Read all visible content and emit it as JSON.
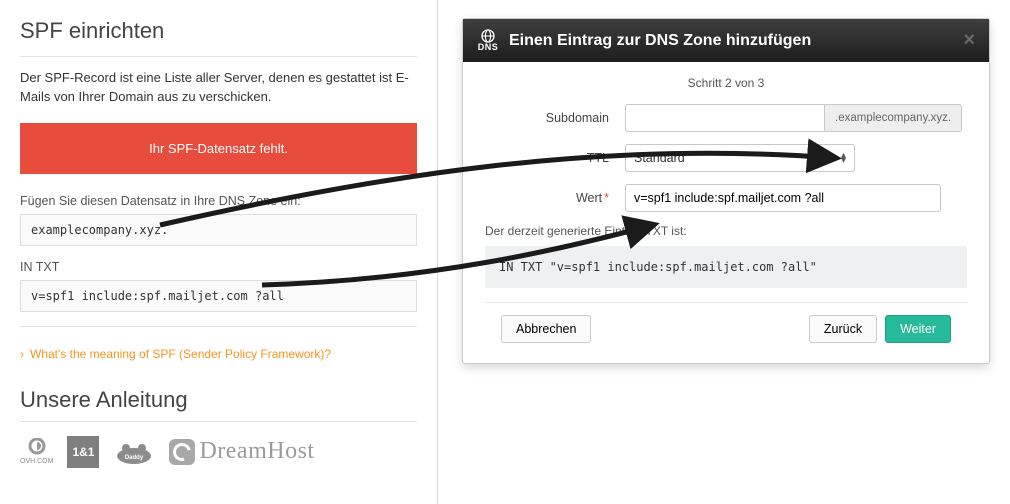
{
  "left": {
    "title": "SPF einrichten",
    "intro": "Der SPF-Record ist eine Liste aller Server, denen es gestattet ist E-Mails von Ihrer Domain aus zu verschicken.",
    "alert": "Ihr SPF-Datensatz fehlt.",
    "insert_label": "Fügen Sie diesen Datensatz in Ihre DNS Zone ein:",
    "domain_value": "examplecompany.xyz.",
    "in_txt_label": "IN TXT",
    "txt_value": "v=spf1 include:spf.mailjet.com ?all",
    "faq_link": "What's the meaning of SPF (Sender Policy Framework)?",
    "guide_title": "Unsere Anleitung",
    "logos": {
      "ovh": "OVH.COM",
      "one_and_one": "1&1",
      "godaddy": "GoDaddy",
      "dreamhost": "DreamHost"
    }
  },
  "modal": {
    "dns_tag": "DNS",
    "title": "Einen Eintrag zur DNS Zone hinzufügen",
    "step": "Schritt 2 von 3",
    "labels": {
      "subdomain": "Subdomain",
      "ttl": "TTL",
      "wert": "Wert"
    },
    "subdomain_value": "",
    "domain_suffix": ".examplecompany.xyz.",
    "ttl_selected": "Standard",
    "wert_value": "v=spf1 include:spf.mailjet.com ?all",
    "generated_label": "Der derzeit generierte Eintrag TXT ist:",
    "generated_value": "IN TXT \"v=spf1 include:spf.mailjet.com ?all\"",
    "buttons": {
      "cancel": "Abbrechen",
      "back": "Zurück",
      "next": "Weiter"
    }
  }
}
